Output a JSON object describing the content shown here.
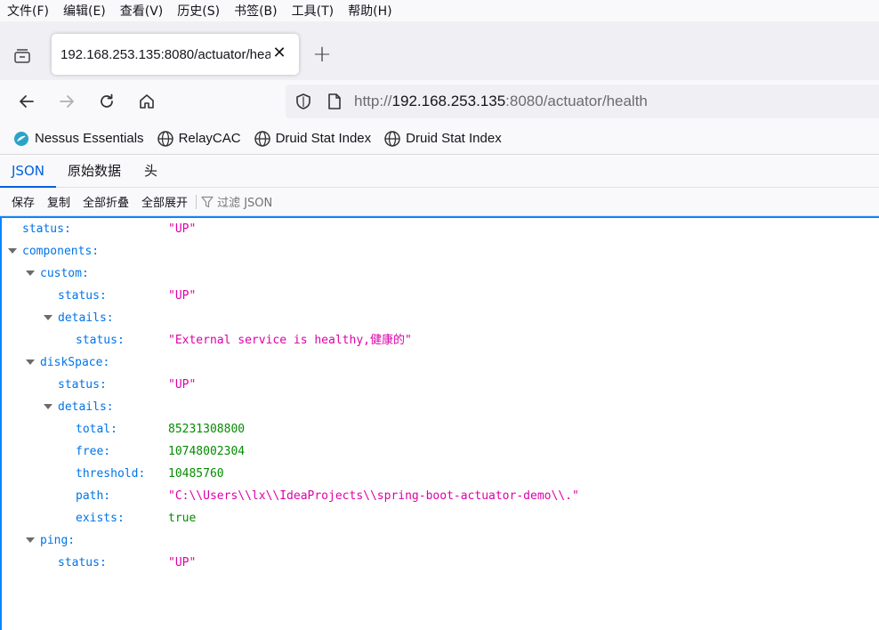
{
  "menu": [
    "文件(F)",
    "编辑(E)",
    "查看(V)",
    "历史(S)",
    "书签(B)",
    "工具(T)",
    "帮助(H)"
  ],
  "tab": {
    "title": "192.168.253.135:8080/actuator/health",
    "close": "✕",
    "new_tab": "+"
  },
  "url": {
    "scheme": "http://",
    "host": "192.168.253.135",
    "rest": ":8080/actuator/health"
  },
  "bookmarks": [
    "Nessus Essentials",
    "RelayCAC",
    "Druid Stat Index",
    "Druid Stat Index"
  ],
  "viewer_tabs": [
    "JSON",
    "原始数据",
    "头"
  ],
  "toolbar": {
    "save": "保存",
    "copy": "复制",
    "collapse_all": "全部折叠",
    "expand_all": "全部展开",
    "filter_placeholder": "过滤 JSON"
  },
  "json": {
    "status_key": "status:",
    "status": "\"UP\"",
    "components_key": "components:",
    "custom_key": "custom:",
    "custom_status": "\"UP\"",
    "custom_details_key": "details:",
    "custom_details_status": "\"External service is healthy,健康的\"",
    "disk_key": "diskSpace:",
    "disk_status": "\"UP\"",
    "disk_details_key": "details:",
    "total_key": "total:",
    "total": "85231308800",
    "free_key": "free:",
    "free": "10748002304",
    "threshold_key": "threshold:",
    "threshold": "10485760",
    "path_key": "path:",
    "path": "\"C:\\\\Users\\\\lx\\\\IdeaProjects\\\\spring-boot-actuator-demo\\\\.\"",
    "exists_key": "exists:",
    "exists": "true",
    "ping_key": "ping:",
    "ping_status": "\"UP\""
  },
  "colors": {
    "key": "#0074e8",
    "string": "#dd00a9",
    "number": "#058b00",
    "accent": "#0061e0"
  }
}
